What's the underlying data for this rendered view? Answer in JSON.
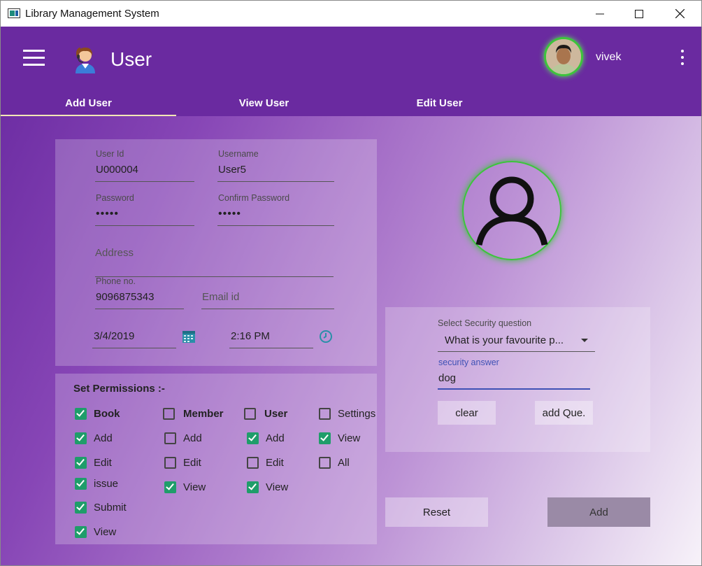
{
  "window": {
    "title": "Library Management System",
    "minimize": "—",
    "maximize": "☐",
    "close": "✕"
  },
  "appbar": {
    "title": "User",
    "username": "vivek"
  },
  "tabs": [
    {
      "label": "Add User",
      "active": true
    },
    {
      "label": "View User",
      "active": false
    },
    {
      "label": "Edit User",
      "active": false
    }
  ],
  "form": {
    "user_id": {
      "label": "User Id",
      "value": "U000004"
    },
    "username": {
      "label": "Username",
      "value": "User5"
    },
    "password": {
      "label": "Password",
      "value": "•••••"
    },
    "confirm_password": {
      "label": "Confirm Password",
      "value": "•••••"
    },
    "address": {
      "placeholder": "Address"
    },
    "phone": {
      "label": "Phone no.",
      "value": "9096875343"
    },
    "email": {
      "placeholder": "Email id"
    },
    "date": {
      "value": "3/4/2019"
    },
    "time": {
      "value": "2:16 PM"
    }
  },
  "permissions": {
    "title": "Set Permissions :-",
    "groups": [
      {
        "name": "Book",
        "checked": true,
        "items": [
          {
            "label": "Add",
            "checked": true
          },
          {
            "label": "Edit",
            "checked": true
          },
          {
            "label": "issue",
            "checked": true
          },
          {
            "label": "Submit",
            "checked": true
          },
          {
            "label": "View",
            "checked": true
          }
        ]
      },
      {
        "name": "Member",
        "checked": false,
        "items": [
          {
            "label": "Add",
            "checked": false
          },
          {
            "label": "Edit",
            "checked": false
          },
          {
            "label": "View",
            "checked": true
          }
        ]
      },
      {
        "name": "User",
        "checked": false,
        "items": [
          {
            "label": "Add",
            "checked": true
          },
          {
            "label": "Edit",
            "checked": false
          },
          {
            "label": "View",
            "checked": true
          }
        ]
      },
      {
        "name": "Settings",
        "checked": false,
        "items": [
          {
            "label": "View",
            "checked": true
          },
          {
            "label": "All",
            "checked": false
          }
        ]
      }
    ]
  },
  "security": {
    "question_label": "Select Security question",
    "question_value": "What is your favourite p...",
    "answer_label": "security answer",
    "answer_value": "dog",
    "clear_label": "clear",
    "add_question_label": "add Que."
  },
  "actions": {
    "reset_label": "Reset",
    "add_label": "Add"
  },
  "colors": {
    "appbar": "#6a2aa0",
    "checkbox": "#1f9d6a",
    "avatar_ring": "#3cc43c",
    "focus_line": "#3f51b5"
  }
}
